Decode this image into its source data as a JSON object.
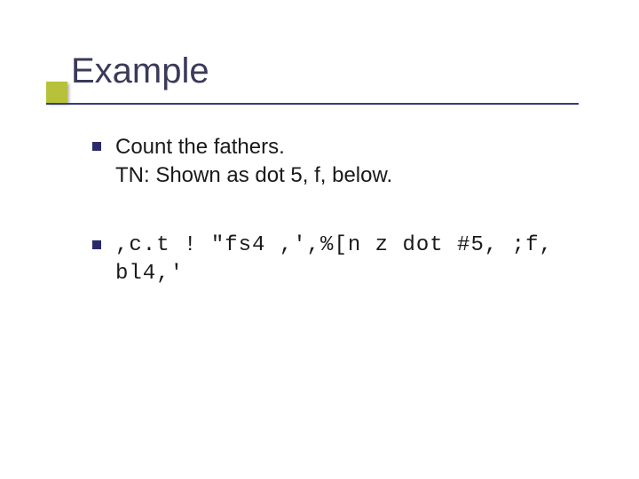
{
  "slide": {
    "title": "Example",
    "items": [
      {
        "line1": "Count the fathers.",
        "line2": "TN: Shown as dot 5, f, below."
      },
      {
        "code": ",c.t ! \"fs4 ,',%[n z dot #5, ;f, bl4,'"
      }
    ]
  }
}
